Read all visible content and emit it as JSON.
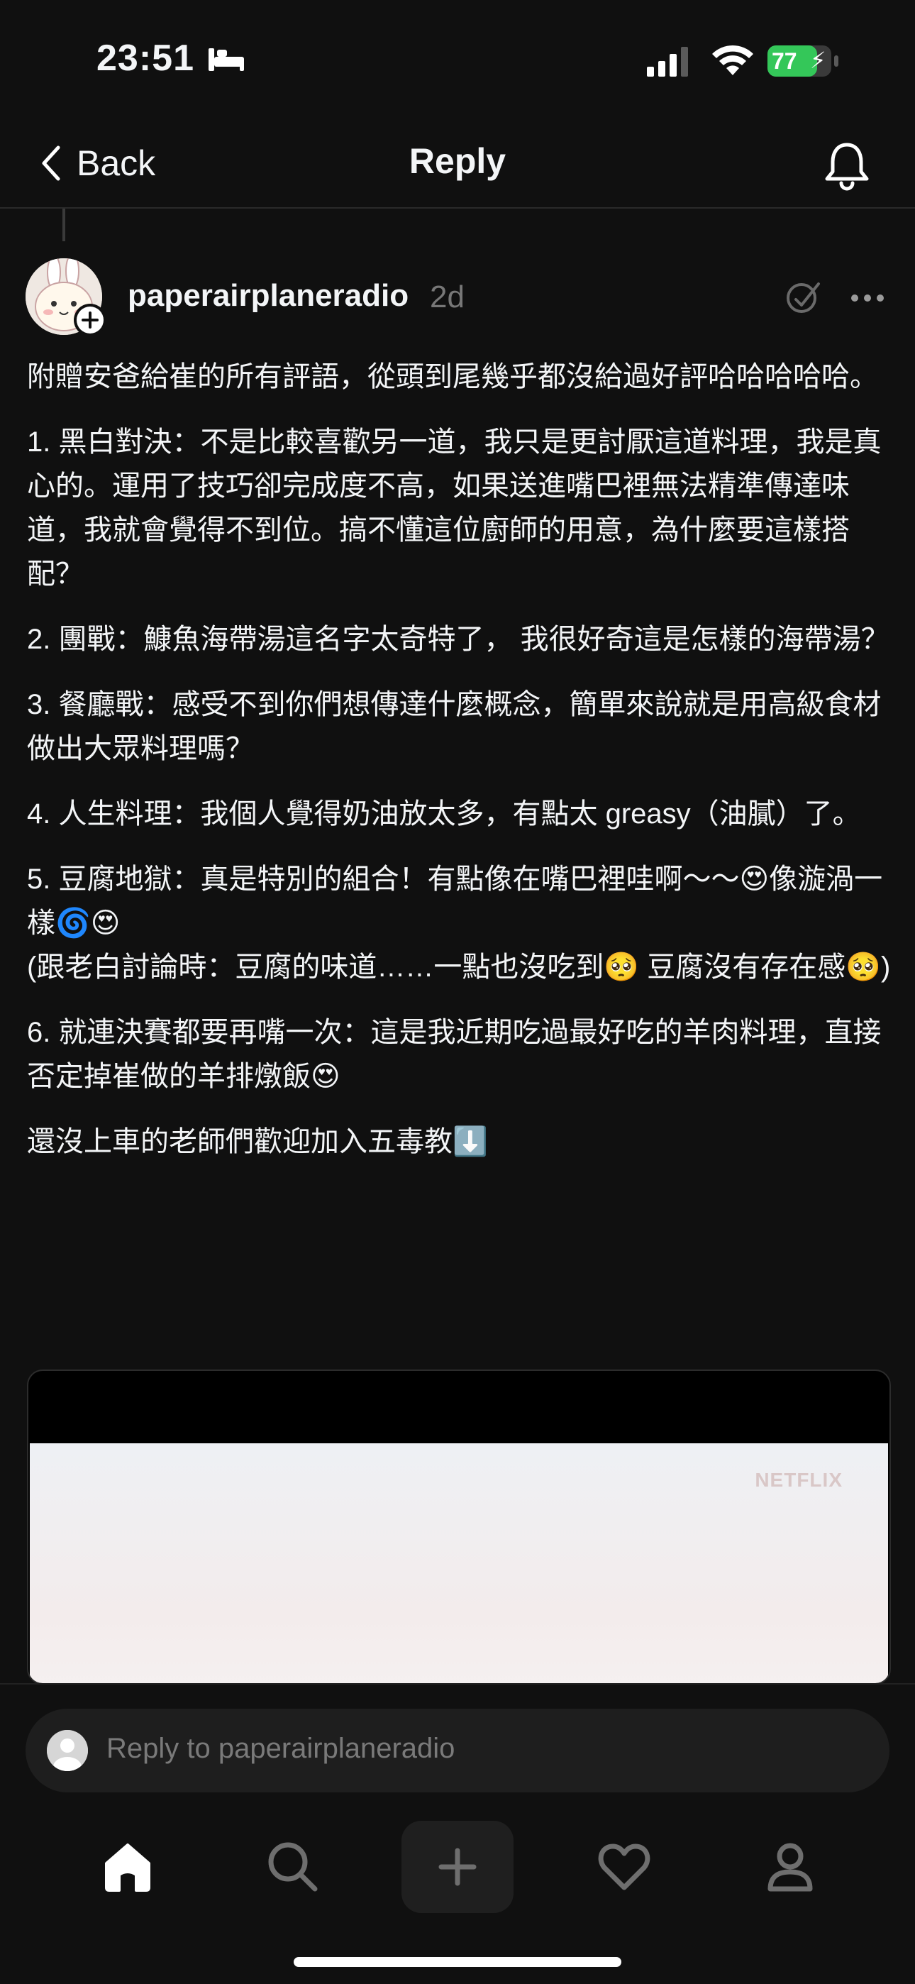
{
  "status_bar": {
    "time": "23:51",
    "battery": "77"
  },
  "header": {
    "back_label": "Back",
    "title": "Reply"
  },
  "post": {
    "username": "paperairplaneradio",
    "age": "2d",
    "paragraphs": [
      "附贈安爸給崔的所有評語，從頭到尾幾乎都沒給過好評哈哈哈哈哈。",
      "1. 黑白對決：不是比較喜歡另一道，我只是更討厭這道料理，我是真心的。運用了技巧卻完成度不高，如果送進嘴巴裡無法精準傳達味道，我就會覺得不到位。搞不懂這位廚師的用意，為什麼要這樣搭配？",
      "2. 團戰：鱇魚海帶湯這名字太奇特了， 我很好奇這是怎樣的海帶湯？",
      "3. 餐廳戰：感受不到你們想傳達什麼概念，簡單來說就是用高級食材做出大眾料理嗎？",
      "4. 人生料理：我個人覺得奶油放太多，有點太 greasy（油膩）了。",
      "5. 豆腐地獄：真是特別的組合！有點像在嘴巴裡哇啊～～😍像漩渦一樣🌀😍\n(跟老白討論時：豆腐的味道……一點也沒吃到🥺 豆腐沒有存在感🥺)",
      "6. 就連決賽都要再嘴一次：這是我近期吃過最好吃的羊肉料理，直接否定掉崔做的羊排燉飯😍",
      "還沒上車的老師們歡迎加入五毒教⬇️"
    ],
    "video_watermark": "NETFLIX"
  },
  "reply": {
    "placeholder": "Reply to paperairplaneradio"
  },
  "nav": {
    "items": [
      "home-icon",
      "search-icon",
      "plus-icon",
      "heart-icon",
      "profile-icon"
    ]
  },
  "colors": {
    "background": "#101010",
    "text": "#f3f5f7",
    "muted": "#777777",
    "battery": "#34c759"
  }
}
